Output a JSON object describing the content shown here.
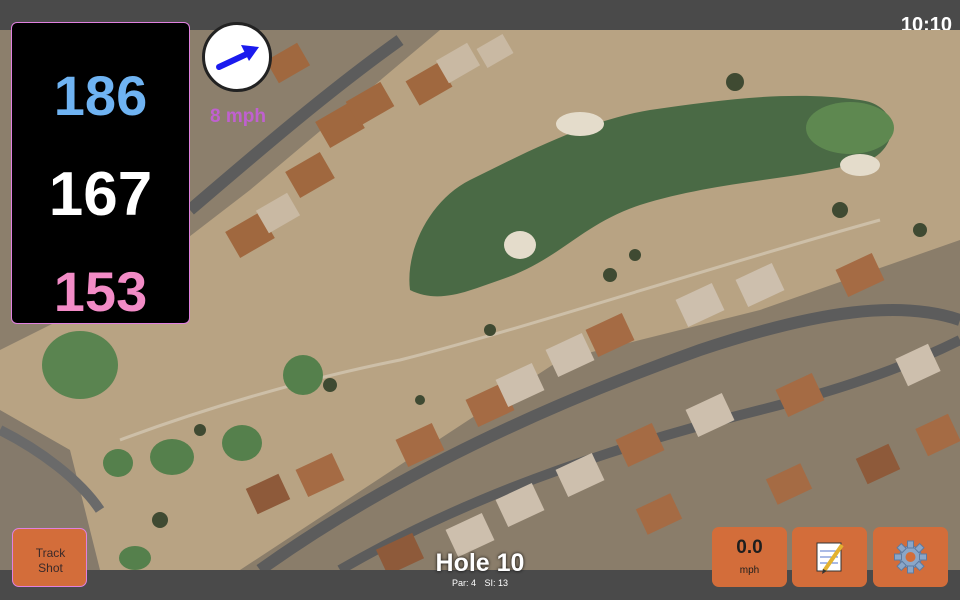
{
  "status_bar": {
    "time": "10:10"
  },
  "distances": {
    "back": "186",
    "middle": "167",
    "front": "153"
  },
  "wind": {
    "speed_label": "8 mph",
    "direction_icon": "arrow-right-icon"
  },
  "hole": {
    "title": "Hole 10",
    "par_label": "Par: 4",
    "si_label": "SI: 13"
  },
  "buttons": {
    "track_shot": {
      "line1": "Track",
      "line2": "Shot"
    },
    "speed": {
      "value": "0.0",
      "unit": "mph"
    },
    "notes": {
      "icon": "notepad-icon"
    },
    "settings": {
      "icon": "gear-icon"
    }
  },
  "colors": {
    "back": "#6fb3f2",
    "middle": "#ffffff",
    "front": "#f28bc6",
    "button": "#d36d3a",
    "wind_text": "#c060d0"
  }
}
